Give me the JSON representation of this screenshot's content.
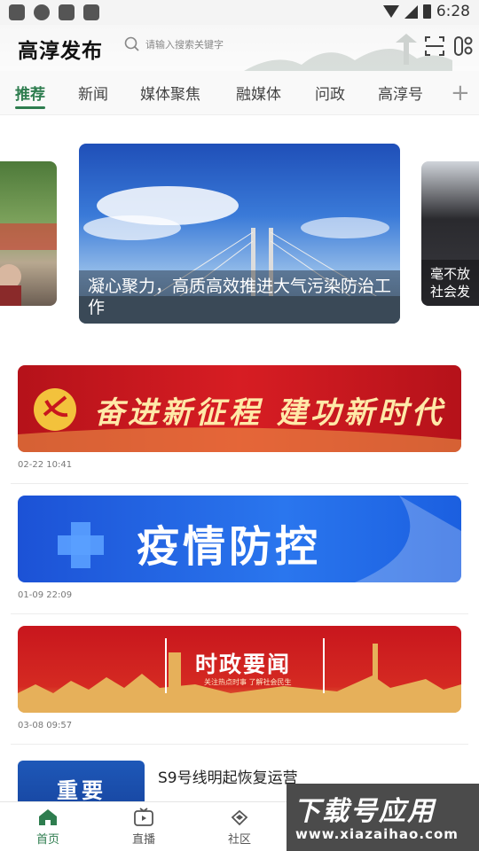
{
  "status": {
    "time": "6:28"
  },
  "header": {
    "title": "高淳发布",
    "search_placeholder": "请输入搜索关键字"
  },
  "tabs": [
    {
      "label": "推荐",
      "active": true
    },
    {
      "label": "新闻",
      "active": false
    },
    {
      "label": "媒体聚焦",
      "active": false
    },
    {
      "label": "融媒体",
      "active": false
    },
    {
      "label": "问政",
      "active": false
    },
    {
      "label": "高淳号",
      "active": false
    }
  ],
  "carousel": {
    "left_caption": "",
    "center_caption": "凝心聚力，高质高效推进大气污染防治工作",
    "right_caption": "毫不放\n社会发"
  },
  "feed": [
    {
      "banner_text": "奋进新征程 建功新时代",
      "date": "02-22 10:41"
    },
    {
      "banner_text": "疫情防控",
      "date": "01-09 22:09"
    },
    {
      "banner_text": "时政要闻",
      "banner_sub": "关注热点时事  了解社会民生",
      "date": "03-08 09:57"
    },
    {
      "thumb_text": "重要",
      "title": "S9号线明起恢复运营"
    }
  ],
  "bottom_nav": [
    {
      "label": "首页",
      "icon": "home-icon",
      "active": true
    },
    {
      "label": "直播",
      "icon": "tv-icon",
      "active": false
    },
    {
      "label": "社区",
      "icon": "community-icon",
      "active": false
    }
  ],
  "watermark": {
    "big": "下载号应用",
    "small": "www.xiazaihao.com"
  },
  "colors": {
    "accent": "#2e7d4f",
    "banner_red": "#c8161d",
    "banner_blue": "#1a5fe0"
  }
}
